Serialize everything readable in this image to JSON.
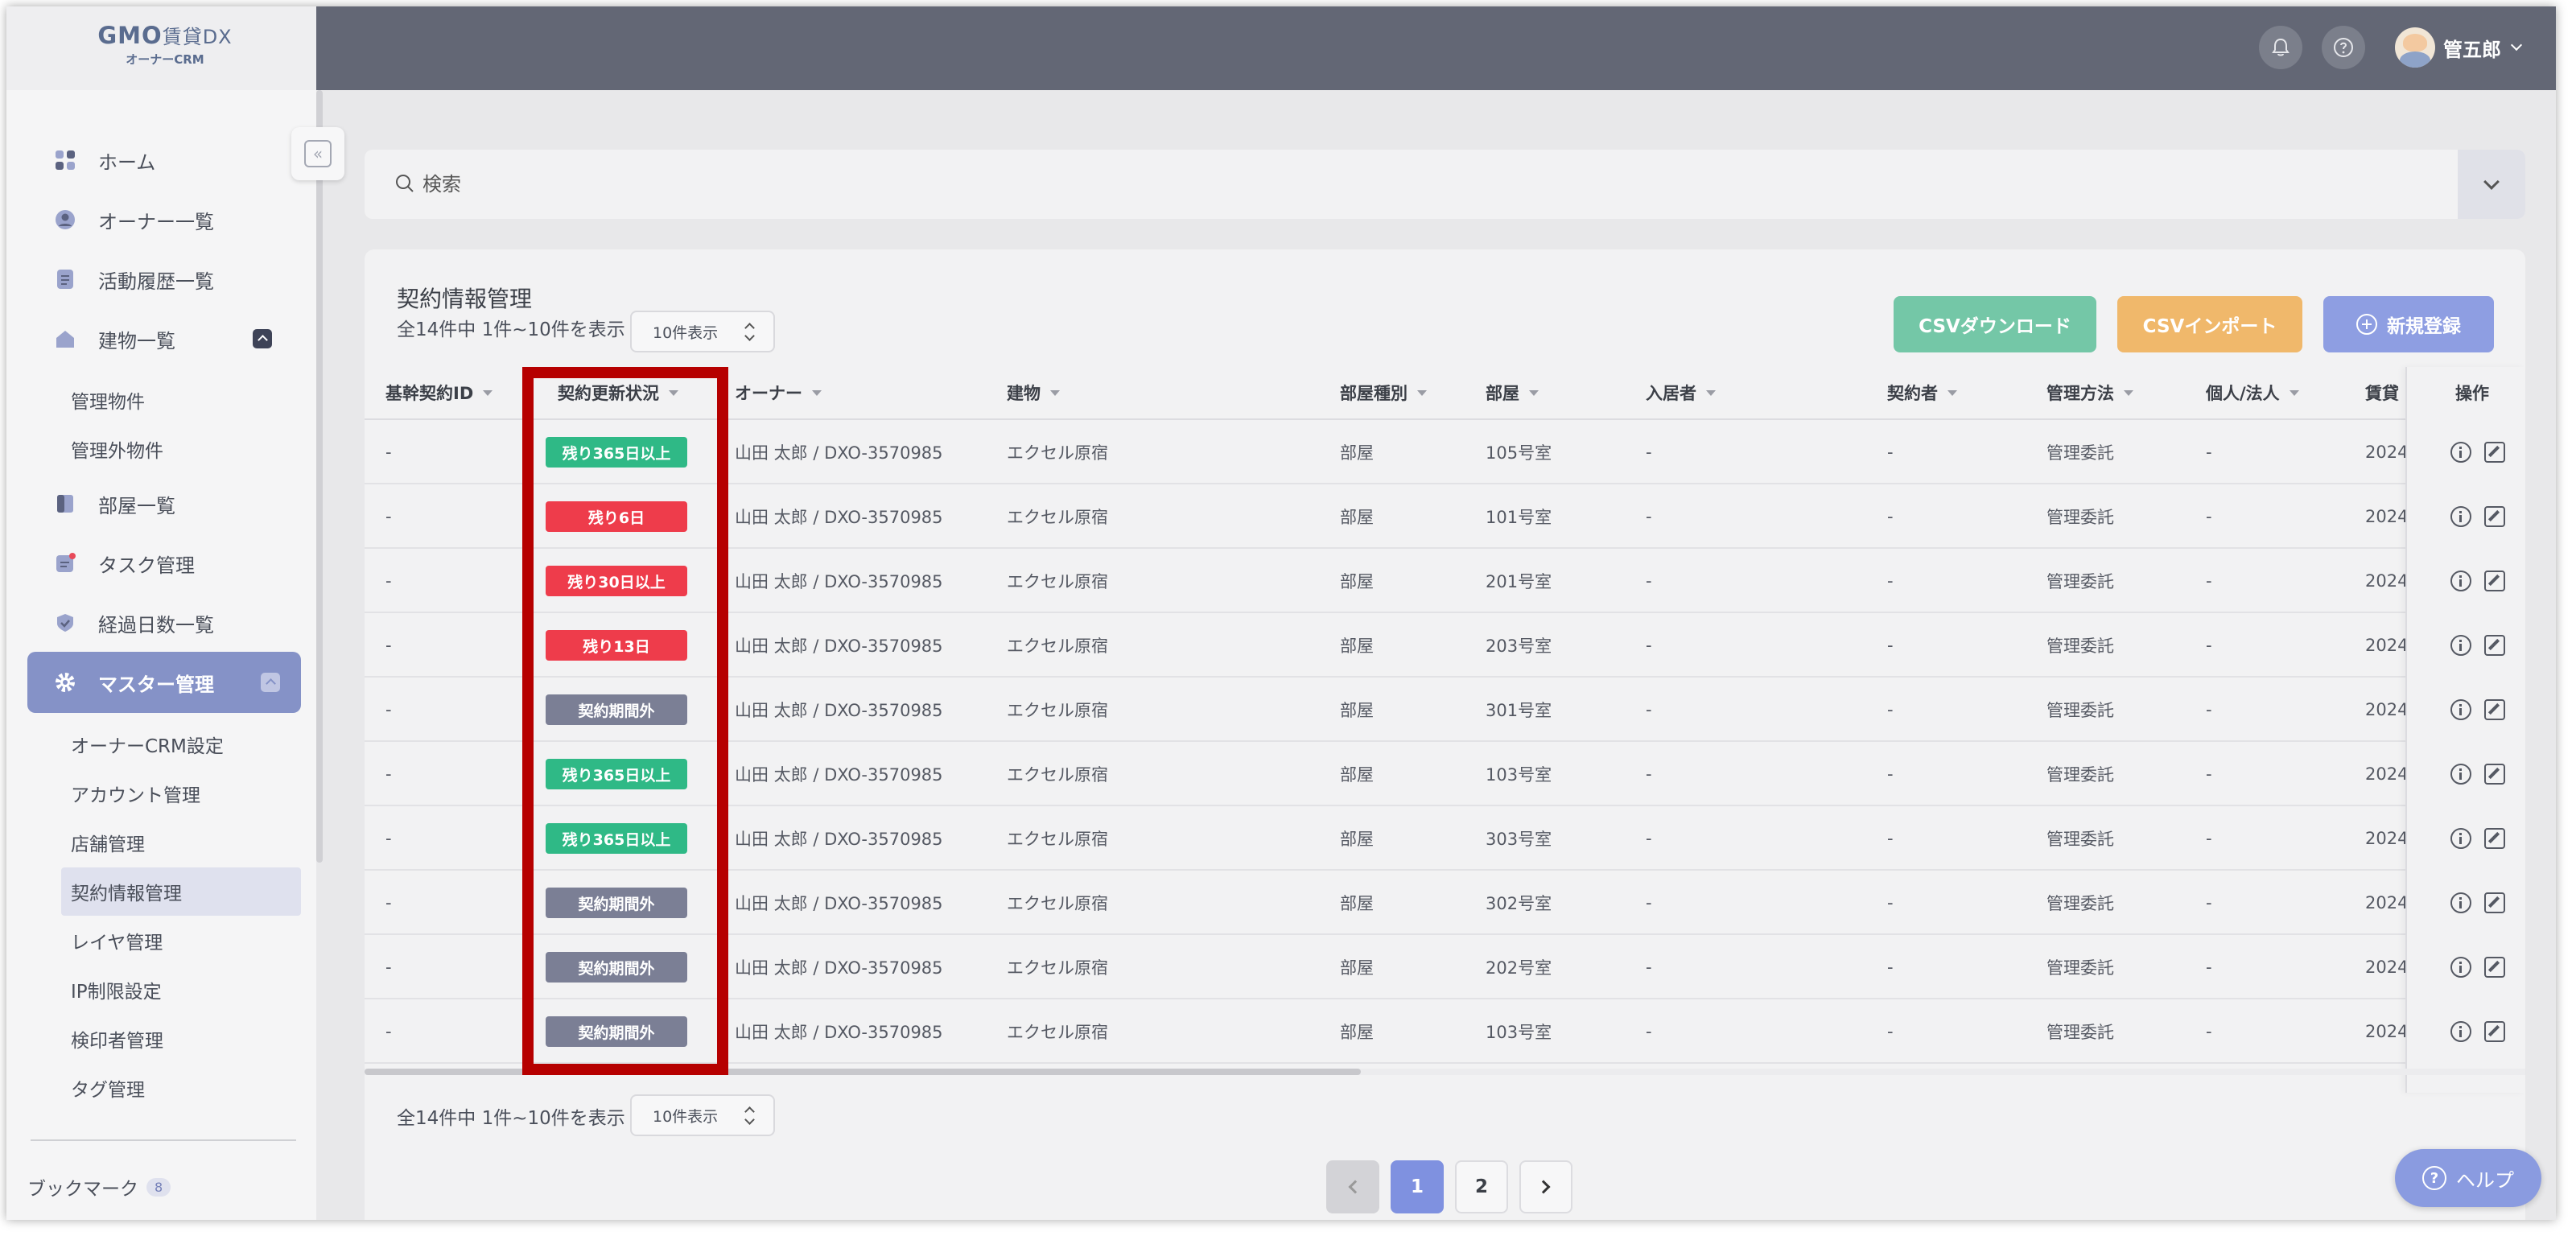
{
  "logo": {
    "brand": "GMO",
    "product": "賃貸DX",
    "subtitle": "オーナーCRM"
  },
  "sidebar": {
    "items": [
      {
        "label": "ホーム",
        "icon": "grid-icon"
      },
      {
        "label": "オーナー一覧",
        "icon": "person-icon"
      },
      {
        "label": "活動履歴一覧",
        "icon": "document-icon"
      },
      {
        "label": "建物一覧",
        "icon": "building-icon"
      },
      {
        "label": "部屋一覧",
        "icon": "door-icon"
      },
      {
        "label": "タスク管理",
        "icon": "task-icon"
      },
      {
        "label": "経過日数一覧",
        "icon": "check-badge-icon"
      },
      {
        "label": "マスター管理",
        "icon": "gear-icon"
      }
    ],
    "building_sub": [
      "管理物件",
      "管理外物件"
    ],
    "master_sub": [
      "オーナーCRM設定",
      "アカウント管理",
      "店舗管理",
      "契約情報管理",
      "レイヤ管理",
      "IP制限設定",
      "検印者管理",
      "タグ管理"
    ],
    "bookmark": {
      "label": "ブックマーク",
      "count": "8"
    }
  },
  "header": {
    "user_name": "管五郎"
  },
  "search": {
    "placeholder": "検索"
  },
  "card": {
    "title": "契約情報管理",
    "summary": "全14件中 1件~10件を表示",
    "page_size": "10件表示",
    "buttons": {
      "csv_download": "CSVダウンロード",
      "csv_import": "CSVインポート",
      "new": "新規登録"
    }
  },
  "table": {
    "columns": [
      "基幹契約ID",
      "契約更新状況",
      "オーナー",
      "建物",
      "部屋種別",
      "部屋",
      "入居者",
      "契約者",
      "管理方法",
      "個人/法人",
      "賃貸",
      "操作"
    ],
    "rows": [
      {
        "id": "-",
        "status": "残り365日以上",
        "status_color": "#2fb986",
        "owner": "山田 太郎 / DXO-3570985",
        "building": "エクセル原宿",
        "room_type": "部屋",
        "room": "105号室",
        "tenant": "-",
        "contractor": "-",
        "method": "管理委託",
        "entity": "-",
        "rent": "2024"
      },
      {
        "id": "-",
        "status": "残り6日",
        "status_color": "#ee3c4b",
        "owner": "山田 太郎 / DXO-3570985",
        "building": "エクセル原宿",
        "room_type": "部屋",
        "room": "101号室",
        "tenant": "-",
        "contractor": "-",
        "method": "管理委託",
        "entity": "-",
        "rent": "2024"
      },
      {
        "id": "-",
        "status": "残り30日以上",
        "status_color": "#ee3c4b",
        "owner": "山田 太郎 / DXO-3570985",
        "building": "エクセル原宿",
        "room_type": "部屋",
        "room": "201号室",
        "tenant": "-",
        "contractor": "-",
        "method": "管理委託",
        "entity": "-",
        "rent": "2024"
      },
      {
        "id": "-",
        "status": "残り13日",
        "status_color": "#ee3c4b",
        "owner": "山田 太郎 / DXO-3570985",
        "building": "エクセル原宿",
        "room_type": "部屋",
        "room": "203号室",
        "tenant": "-",
        "contractor": "-",
        "method": "管理委託",
        "entity": "-",
        "rent": "2024"
      },
      {
        "id": "-",
        "status": "契約期間外",
        "status_color": "#7b7f95",
        "owner": "山田 太郎 / DXO-3570985",
        "building": "エクセル原宿",
        "room_type": "部屋",
        "room": "301号室",
        "tenant": "-",
        "contractor": "-",
        "method": "管理委託",
        "entity": "-",
        "rent": "2024"
      },
      {
        "id": "-",
        "status": "残り365日以上",
        "status_color": "#2fb986",
        "owner": "山田 太郎 / DXO-3570985",
        "building": "エクセル原宿",
        "room_type": "部屋",
        "room": "103号室",
        "tenant": "-",
        "contractor": "-",
        "method": "管理委託",
        "entity": "-",
        "rent": "2024"
      },
      {
        "id": "-",
        "status": "残り365日以上",
        "status_color": "#2fb986",
        "owner": "山田 太郎 / DXO-3570985",
        "building": "エクセル原宿",
        "room_type": "部屋",
        "room": "303号室",
        "tenant": "-",
        "contractor": "-",
        "method": "管理委託",
        "entity": "-",
        "rent": "2024"
      },
      {
        "id": "-",
        "status": "契約期間外",
        "status_color": "#7b7f95",
        "owner": "山田 太郎 / DXO-3570985",
        "building": "エクセル原宿",
        "room_type": "部屋",
        "room": "302号室",
        "tenant": "-",
        "contractor": "-",
        "method": "管理委託",
        "entity": "-",
        "rent": "2024"
      },
      {
        "id": "-",
        "status": "契約期間外",
        "status_color": "#7b7f95",
        "owner": "山田 太郎 / DXO-3570985",
        "building": "エクセル原宿",
        "room_type": "部屋",
        "room": "202号室",
        "tenant": "-",
        "contractor": "-",
        "method": "管理委託",
        "entity": "-",
        "rent": "2024"
      },
      {
        "id": "-",
        "status": "契約期間外",
        "status_color": "#7b7f95",
        "owner": "山田 太郎 / DXO-3570985",
        "building": "エクセル原宿",
        "room_type": "部屋",
        "room": "103号室",
        "tenant": "-",
        "contractor": "-",
        "method": "管理委託",
        "entity": "-",
        "rent": "2024"
      }
    ]
  },
  "pagination": {
    "pages": [
      "1",
      "2"
    ],
    "current": "1"
  },
  "help": {
    "label": "ヘルプ"
  },
  "colors": {
    "highlight": "#b60000",
    "accent": "#8592c7"
  }
}
